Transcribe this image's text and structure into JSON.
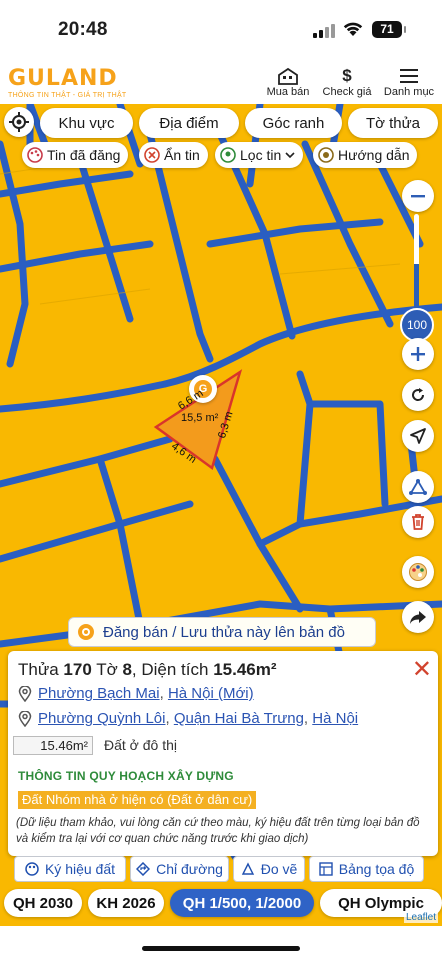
{
  "status_bar": {
    "time": "20:48",
    "battery": "71"
  },
  "app": {
    "brand": "GULAND",
    "tagline": "THÔNG TIN THẬT - GIÁ TRỊ THẬT",
    "nav": [
      {
        "label": "Mua bán",
        "icon": "house-icon"
      },
      {
        "label": "Check giá",
        "icon": "dollar-icon"
      },
      {
        "label": "Danh mục",
        "icon": "hamburger-menu-icon"
      }
    ]
  },
  "filters": {
    "primary": [
      "Khu vực",
      "Địa điểm",
      "Góc ranh",
      "Tờ thửa"
    ],
    "secondary": [
      "Tin đã đăng",
      "Ẩn tin",
      "Lọc tin",
      "Hướng dẫn"
    ]
  },
  "map": {
    "colors": {
      "background": "#f9b801",
      "roads": "#2a5ec2",
      "parcel": "#f39b1c",
      "parcel_border": "#d9352b"
    },
    "zoom_level": "100",
    "parcel_labels": {
      "edge_top": "6,6 m",
      "edge_right": "6,3 m",
      "edge_bottom": "4,6 m",
      "area": "15,5 m²"
    },
    "post_button": "Đăng bán / Lưu thửa này lên bản đồ"
  },
  "panel": {
    "title_prefix": "Thửa ",
    "plot_number": "170",
    "sheet_prefix": " Tờ ",
    "sheet_number": "8",
    "area_prefix": ", Diện tích ",
    "area": "15.46m²",
    "address_new": {
      "ward": "Phường Bạch Mai",
      "city": "Hà Nội (Mới)"
    },
    "address_old": {
      "ward": "Phường Quỳnh Lôi",
      "district": "Quận Hai Bà Trưng",
      "city": "Hà Nội"
    },
    "area_value": "15.46m²",
    "land_type": "Đất ở đô thị",
    "section_title": "THÔNG TIN QUY HOẠCH XÂY DỰNG",
    "zone": "Đất Nhóm nhà ở hiện có (Đất ở dân cư)",
    "note": "(Dữ liệu tham khảo, vui lòng căn cứ theo màu, ký hiệu đất trên từng loại bản đồ và kiểm tra lại với cơ quan chức năng trước khi giao dịch)",
    "actions": [
      "Ký hiệu đất",
      "Chỉ đường",
      "Đo vẽ",
      "Bảng tọa độ"
    ]
  },
  "plan_tabs": {
    "items": [
      "QH 2030",
      "KH 2026",
      "QH 1/500, 1/2000",
      "QH Olympic"
    ],
    "active": "QH 1/500, 1/2000"
  },
  "attribution": "Leaflet"
}
